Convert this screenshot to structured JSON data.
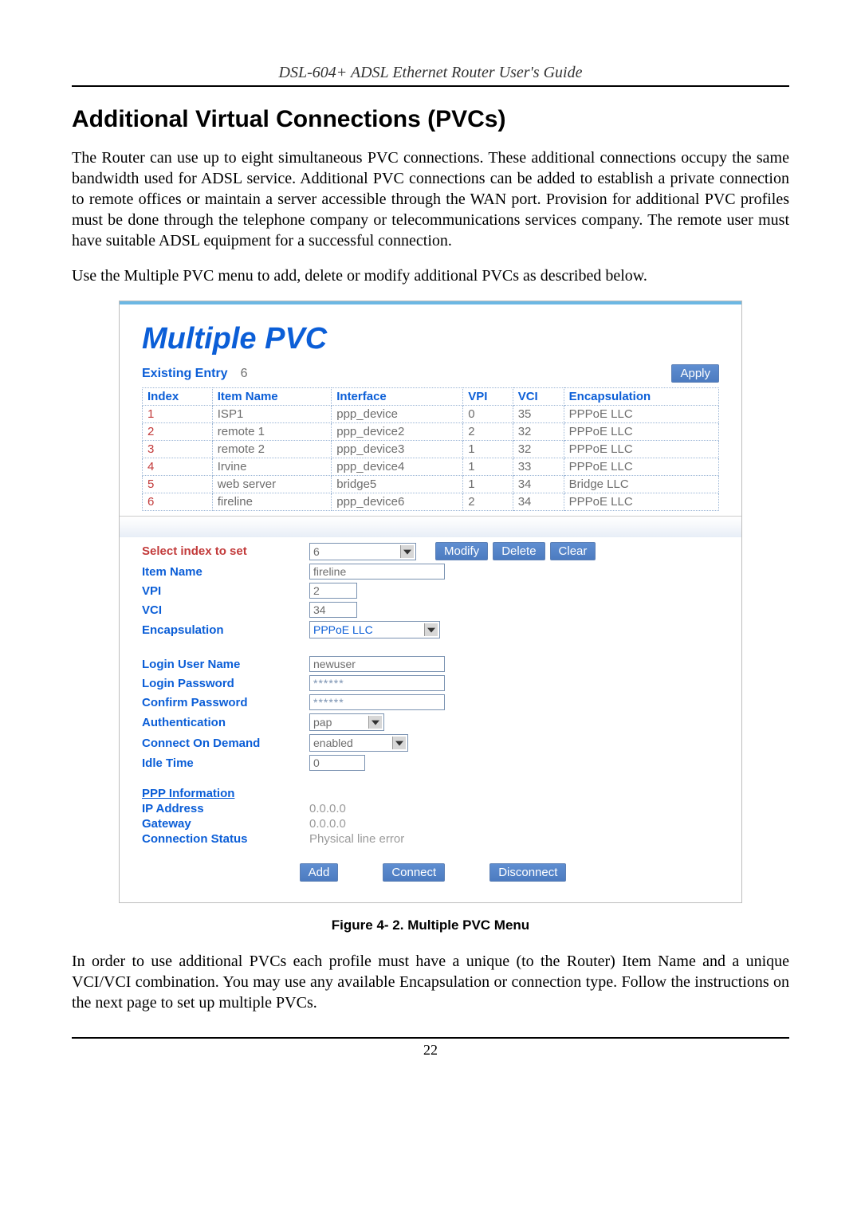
{
  "header": {
    "running": "DSL-604+ ADSL Ethernet Router User's Guide"
  },
  "section": {
    "title": "Additional Virtual Connections (PVCs)",
    "para1": "The Router can use up to eight simultaneous PVC connections. These additional connections occupy the same bandwidth used for ADSL service. Additional PVC connections can be added to establish a private connection to remote offices or maintain a server accessible through the WAN port. Provision for additional PVC profiles must be done through the telephone company or telecommunications services company. The remote user must have suitable ADSL equipment for a successful connection.",
    "para2": "Use the Multiple PVC menu to add, delete or modify additional PVCs as described below."
  },
  "panel": {
    "title": "Multiple PVC",
    "existing_label": "Existing Entry",
    "existing_count": "6",
    "apply": "Apply",
    "table": {
      "headers": [
        "Index",
        "Item Name",
        "Interface",
        "VPI",
        "VCI",
        "Encapsulation"
      ],
      "rows": [
        [
          "1",
          "ISP1",
          "ppp_device",
          "0",
          "35",
          "PPPoE LLC"
        ],
        [
          "2",
          "remote 1",
          "ppp_device2",
          "2",
          "32",
          "PPPoE LLC"
        ],
        [
          "3",
          "remote 2",
          "ppp_device3",
          "1",
          "32",
          "PPPoE LLC"
        ],
        [
          "4",
          "Irvine",
          "ppp_device4",
          "1",
          "33",
          "PPPoE LLC"
        ],
        [
          "5",
          "web server",
          "bridge5",
          "1",
          "34",
          "Bridge LLC"
        ],
        [
          "6",
          "fireline",
          "ppp_device6",
          "2",
          "34",
          "PPPoE LLC"
        ]
      ]
    },
    "select_label": "Select index to set",
    "select_value": "6",
    "modify": "Modify",
    "delete": "Delete",
    "clear": "Clear",
    "fields": {
      "item_name": {
        "label": "Item Name",
        "value": "fireline"
      },
      "vpi": {
        "label": "VPI",
        "value": "2"
      },
      "vci": {
        "label": "VCI",
        "value": "34"
      },
      "encap": {
        "label": "Encapsulation",
        "value": "PPPoE LLC"
      },
      "login_user": {
        "label": "Login User Name",
        "value": "newuser"
      },
      "login_pw": {
        "label": "Login Password",
        "value": "******"
      },
      "confirm_pw": {
        "label": "Confirm Password",
        "value": "******"
      },
      "auth": {
        "label": "Authentication",
        "value": "pap"
      },
      "cod": {
        "label": "Connect On Demand",
        "value": "enabled"
      },
      "idle": {
        "label": "Idle Time",
        "value": "0"
      }
    },
    "ppp_info": {
      "heading": "PPP Information",
      "ip": {
        "label": "IP Address",
        "value": "0.0.0.0"
      },
      "gw": {
        "label": "Gateway",
        "value": "0.0.0.0"
      },
      "status": {
        "label": "Connection Status",
        "value": "Physical line error"
      }
    },
    "buttons": {
      "add": "Add",
      "connect": "Connect",
      "disconnect": "Disconnect"
    }
  },
  "caption": "Figure 4- 2. Multiple PVC Menu",
  "closing": "In order to use additional PVCs each profile must have a unique (to the Router) Item Name and a unique VCI/VCI combination. You may use any available Encapsulation or connection type. Follow the instructions on the next page to set up multiple PVCs.",
  "footer": {
    "page": "22"
  }
}
